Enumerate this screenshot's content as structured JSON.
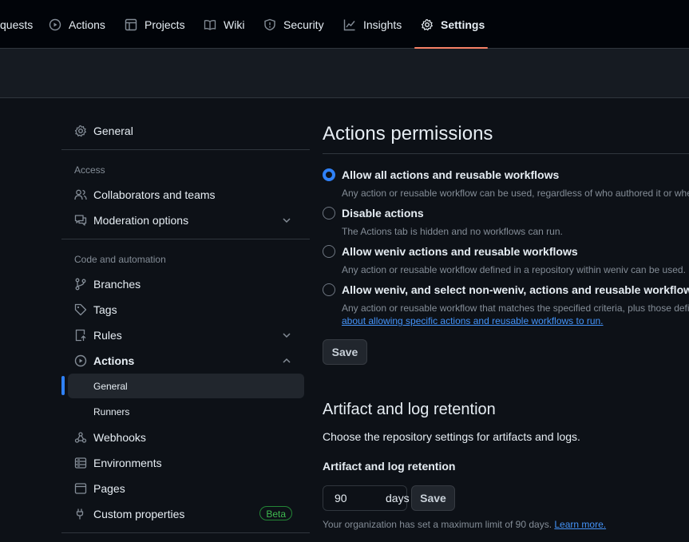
{
  "topnav": {
    "tabs": [
      {
        "label": "quests",
        "icon": "pull-request-icon"
      },
      {
        "label": "Actions",
        "icon": "play-circle-icon"
      },
      {
        "label": "Projects",
        "icon": "table-icon"
      },
      {
        "label": "Wiki",
        "icon": "book-icon"
      },
      {
        "label": "Security",
        "icon": "shield-icon"
      },
      {
        "label": "Insights",
        "icon": "graph-icon"
      },
      {
        "label": "Settings",
        "icon": "gear-icon",
        "selected": true
      }
    ],
    "accent_color": "#f78166"
  },
  "sidebar": {
    "general": "General",
    "access_heading": "Access",
    "collaborators": "Collaborators and teams",
    "moderation": "Moderation options",
    "code_heading": "Code and automation",
    "branches": "Branches",
    "tags": "Tags",
    "rules": "Rules",
    "actions": "Actions",
    "actions_general": "General",
    "actions_runners": "Runners",
    "webhooks": "Webhooks",
    "environments": "Environments",
    "pages": "Pages",
    "custom_properties": "Custom properties",
    "beta_badge": "Beta"
  },
  "main": {
    "permissions_title": "Actions permissions",
    "options": [
      {
        "label": "Allow all actions and reusable workflows",
        "desc": "Any action or reusable workflow can be used, regardless of who authored it or whe",
        "checked": true
      },
      {
        "label": "Disable actions",
        "desc": "The Actions tab is hidden and no workflows can run.",
        "checked": false
      },
      {
        "label": "Allow weniv actions and reusable workflows",
        "desc": "Any action or reusable workflow defined in a repository within weniv can be used.",
        "checked": false
      },
      {
        "label": "Allow weniv, and select non-weniv, actions and reusable workflows",
        "desc": "Any action or reusable workflow that matches the specified criteria, plus those defi",
        "checked": false
      }
    ],
    "learn_link": "about allowing specific actions and reusable workflows to run.",
    "save_label": "Save",
    "retention_title": "Artifact and log retention",
    "retention_desc": "Choose the repository settings for artifacts and logs.",
    "retention_label": "Artifact and log retention",
    "retention_value": "90",
    "retention_unit": "days",
    "retention_save": "Save",
    "retention_note": "Your organization has set a maximum limit of 90 days.",
    "learn_more": "Learn more."
  },
  "colors": {
    "background": "#0d1117",
    "link": "#4493f8",
    "radio_selected": "#2f81f7",
    "beta_green": "#3fb950"
  }
}
